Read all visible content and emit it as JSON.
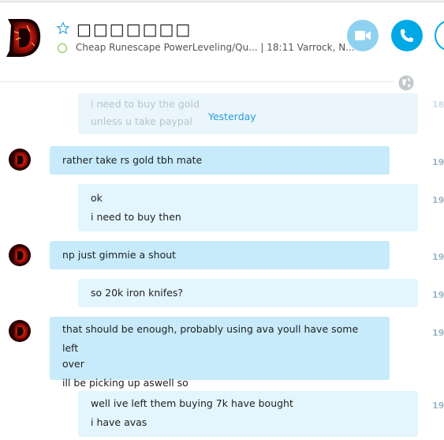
{
  "header": {
    "title": "□□□□□□□",
    "mood": "Cheap Runescape PowerLeveling/Qu...  | 18:11 Varrock, N...",
    "presence_color": "#7cbf3f"
  },
  "colors": {
    "accent": "#00a9e6",
    "video": "#8fd2ef",
    "bubble_theirs": "#c7ebfb",
    "bubble_mine": "#e3f5fd",
    "timestamp": "#9fb7c5"
  },
  "feed": {
    "ghost_lines": [
      "i need to buy the gold",
      "unless u take paypal"
    ],
    "ghost_time": "18",
    "day_separator": "Yesterday",
    "messages": [
      {
        "sender": "them",
        "lines": [
          "rather take rs gold tbh mate"
        ],
        "time": "19:"
      },
      {
        "sender": "me",
        "lines": [
          "ok",
          "i need to buy then"
        ],
        "time": "19:"
      },
      {
        "sender": "them",
        "lines": [
          "np just gimmie a shout"
        ],
        "time": "19:"
      },
      {
        "sender": "me",
        "lines": [
          "so 20k iron knifes?"
        ],
        "time": "19:"
      },
      {
        "sender": "them",
        "lines": [
          "that should be enough, probably using ava youll have some left",
          "over",
          "ill be picking up aswell so"
        ],
        "time": "19:"
      },
      {
        "sender": "me",
        "lines": [
          "well ive left them buying 7k have bought",
          "i have avas"
        ],
        "time": "19:"
      }
    ]
  },
  "icons": [
    "avatar",
    "star-icon",
    "presence-icon",
    "video-call-icon",
    "phone-icon",
    "add-participant-icon",
    "globe-icon"
  ]
}
